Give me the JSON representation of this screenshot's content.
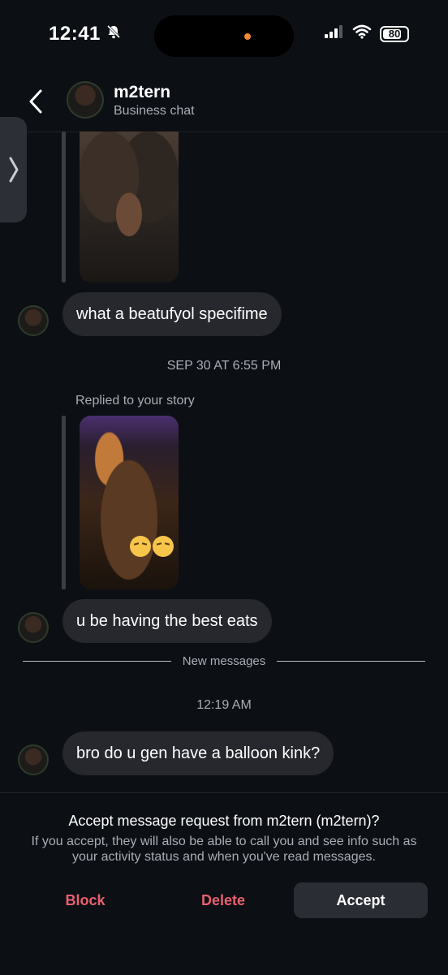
{
  "status_bar": {
    "time": "12:41",
    "battery": "80",
    "battery_level": 0.8,
    "icons": [
      "bell-slash-icon",
      "cellular-signal-icon",
      "wifi-icon",
      "battery-icon"
    ]
  },
  "header": {
    "name": "m2tern",
    "subtitle": "Business chat"
  },
  "messages": [
    {
      "type": "story_image",
      "subject": "portrait"
    },
    {
      "type": "text",
      "text": "what a beatufyol specifime"
    },
    {
      "type": "timestamp",
      "text": "SEP 30 AT 6:55 PM"
    },
    {
      "type": "reply_label",
      "text": "Replied to your story"
    },
    {
      "type": "story_image",
      "subject": "food"
    },
    {
      "type": "text",
      "text": "u be having the best eats"
    },
    {
      "type": "divider",
      "text": "New messages"
    },
    {
      "type": "timestamp",
      "text": "12:19 AM"
    },
    {
      "type": "text",
      "text": "bro do u gen have a balloon kink?"
    }
  ],
  "request": {
    "title": "Accept message request from m2tern (m2tern)?",
    "body": "If you accept, they will also be able to call you and see info such as your activity status and when you've read messages.",
    "block_label": "Block",
    "delete_label": "Delete",
    "accept_label": "Accept"
  },
  "colors": {
    "background": "#0c0f14",
    "bubble": "#26282d",
    "danger": "#e8606f",
    "muted_text": "#a8adb6",
    "island_dot": "#f08a32"
  }
}
